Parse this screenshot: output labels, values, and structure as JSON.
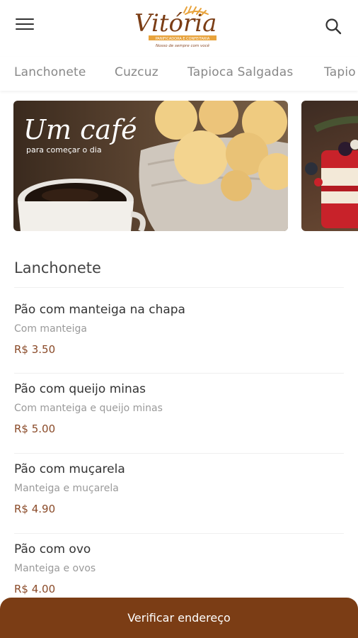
{
  "header": {
    "logo": {
      "title": "Vitória",
      "tagline": "PANIFICADORA E CONFEITARIA",
      "slogan": "Nosso de sempre com você"
    }
  },
  "tabs": [
    "Lanchonete",
    "Cuzcuz",
    "Tapioca Salgadas",
    "Tapio"
  ],
  "banners": [
    {
      "headline": "Um café",
      "subline": "para começar o dia"
    }
  ],
  "section": {
    "title": "Lanchonete",
    "items": [
      {
        "name": "Pão com manteiga na chapa",
        "description": "Com manteiga",
        "price": "R$ 3.50"
      },
      {
        "name": "Pão com queijo minas",
        "description": "Com manteiga e queijo minas",
        "price": "R$ 5.00"
      },
      {
        "name": "Pão com muçarela",
        "description": "Manteiga e muçarela",
        "price": "R$ 4.90"
      },
      {
        "name": "Pão com ovo",
        "description": "Manteiga e ovos",
        "price": "R$ 4.00"
      }
    ]
  },
  "bottom_bar": {
    "label": "Verificar endereço"
  },
  "colors": {
    "brand": "#7b3d15",
    "price": "#8a4a28",
    "logo_accent": "#e8a33c"
  }
}
